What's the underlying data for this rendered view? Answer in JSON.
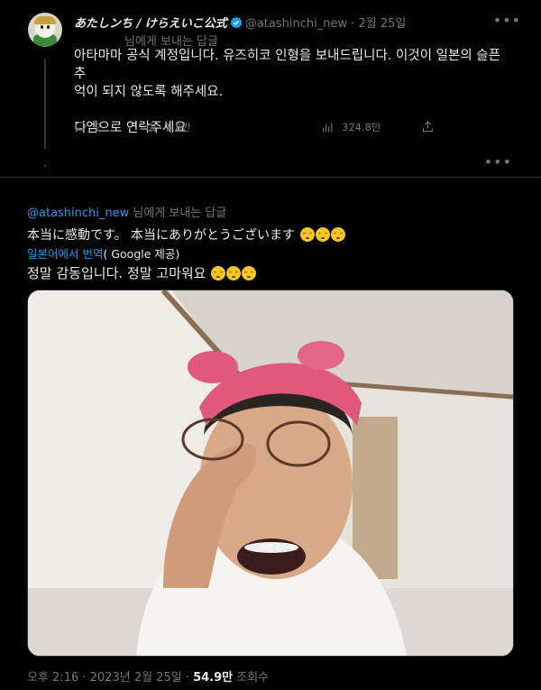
{
  "parent_tweet": {
    "display_name": "あたしンち / けらえいこ公式",
    "handle": "@atashinchi_new",
    "dot": "·",
    "date": "2월 25일",
    "replying_to": "님에게 보내는 답글",
    "text_line1": "아타마마 공식 계정입니다. 유즈히코 인형을 보내드립니다. 이것이 일본의 슬픈 추",
    "text_line2": "억이 되지 않도록 해주세요.",
    "text_line3": "디엠으로 연락주세요",
    "replies": "2",
    "retweets": "1.8만",
    "views": "324.8만"
  },
  "main_tweet": {
    "reply_mention": "@atashinchi_new",
    "reply_rest": " 님에게 보내는 답글",
    "text_jp": "本当に感動です。 本当にありがとうございます",
    "translate_link": "일본어에서 번역",
    "translate_provider": "( Google 제공)",
    "text_ko": "정말 감동입니다. 정말 고마워요",
    "time_date": "오후 2:16 · 2023년 2월 25일 · ",
    "view_count": "54.9만",
    "view_label": " 조회수"
  },
  "icons": [
    "verified-badge-icon",
    "more-icon",
    "reply-icon",
    "retweet-icon",
    "analytics-icon",
    "share-icon",
    "emoji-icon"
  ],
  "colors": {
    "background": "#000000",
    "text": "#e7e9ea",
    "muted": "#71767b",
    "accent": "#1d9bf0"
  }
}
